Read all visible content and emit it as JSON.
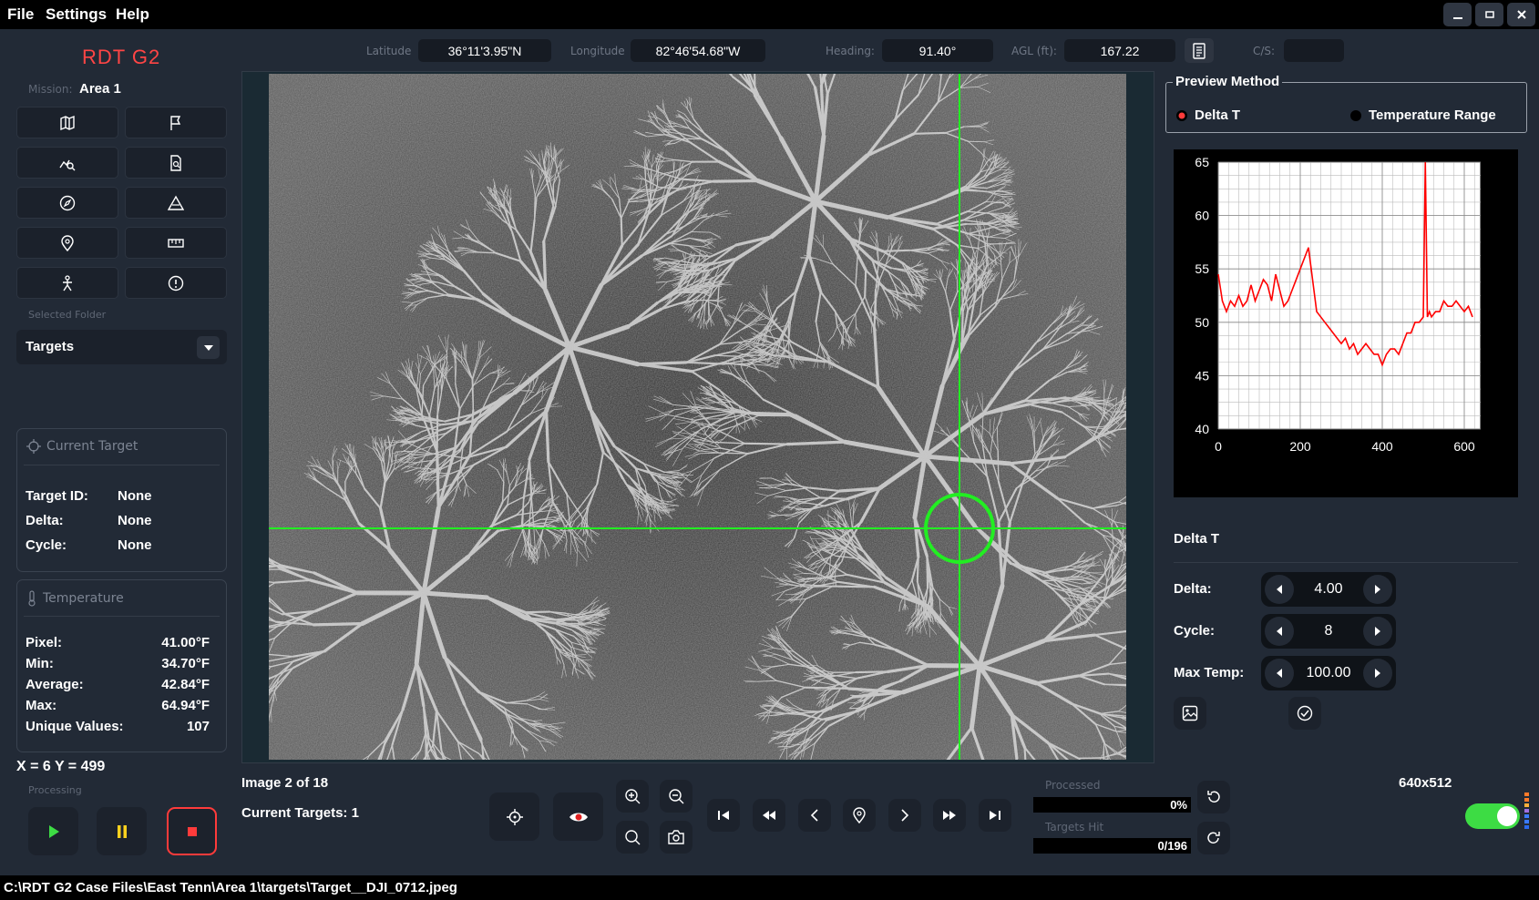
{
  "menu": {
    "file": "File",
    "settings": "Settings",
    "help": "Help"
  },
  "window_buttons": [
    "minimize-icon",
    "maximize-icon",
    "close-icon"
  ],
  "info_bar": {
    "latitude_label": "Latitude",
    "latitude_value": "36°11'3.95\"N",
    "longitude_label": "Longitude",
    "longitude_value": "82°46'54.68\"W",
    "heading_label": "Heading:",
    "heading_value": "91.40°",
    "agl_label": "AGL (ft):",
    "agl_value": "167.22",
    "cs_label": "C/S:",
    "cs_value": ""
  },
  "left": {
    "logo": "RDT G2",
    "mission_label": "Mission:",
    "mission_value": "Area 1",
    "tools": [
      "map-icon",
      "flag-icon",
      "chart-search-icon",
      "document-search-icon",
      "compass-icon",
      "triangle-pattern-icon",
      "pin-icon",
      "measure-icon",
      "person-icon",
      "alert-icon"
    ],
    "selected_folder_label": "Selected Folder",
    "folder_value": "Targets",
    "current_target": {
      "title": "Current Target",
      "target_id_label": "Target ID:",
      "target_id_value": "None",
      "delta_label": "Delta:",
      "delta_value": "None",
      "cycle_label": "Cycle:",
      "cycle_value": "None"
    },
    "temperature": {
      "title": "Temperature",
      "pixel_label": "Pixel:",
      "pixel_value": "41.00°F",
      "min_label": "Min:",
      "min_value": "34.70°F",
      "avg_label": "Average:",
      "avg_value": "42.84°F",
      "max_label": "Max:",
      "max_value": "64.94°F",
      "unique_label": "Unique Values:",
      "unique_value": "107"
    },
    "coords": "X = 6 Y = 499",
    "processing_label": "Processing"
  },
  "bottom": {
    "image_counter": "Image 2 of 18",
    "current_targets": "Current Targets: 1",
    "processed_label": "Processed",
    "processed_value": "0%",
    "processed_fraction": 0,
    "targets_hit_label": "Targets Hit",
    "targets_hit_value": "0/196",
    "targets_hit_fraction": 0,
    "resolution": "640x512",
    "toggle_on": true
  },
  "right": {
    "preview_method_title": "Preview Method",
    "option_delta": "Delta T",
    "option_range": "Temperature Range",
    "selected": "Delta T",
    "delta_t_heading": "Delta T",
    "delta_label": "Delta:",
    "delta_value": "4.00",
    "cycle_label": "Cycle:",
    "cycle_value": "8",
    "max_temp_label": "Max Temp:",
    "max_temp_value": "100.00"
  },
  "colors": {
    "accent_red": "#ff3b3b",
    "crosshair": "#22ee22",
    "toggle_green": "#3ddc44",
    "background": "#222a36"
  },
  "chart_data": {
    "type": "line",
    "xlim": [
      0,
      640
    ],
    "ylim": [
      40,
      65
    ],
    "xticks": [
      0,
      200,
      400,
      600
    ],
    "yticks": [
      40,
      45,
      50,
      55,
      60,
      65
    ],
    "grid": true,
    "series": [
      {
        "color": "#ff0000",
        "x": [
          0,
          10,
          20,
          30,
          40,
          50,
          60,
          70,
          80,
          90,
          100,
          110,
          120,
          130,
          140,
          150,
          160,
          170,
          180,
          190,
          200,
          210,
          220,
          230,
          240,
          250,
          260,
          270,
          280,
          290,
          300,
          310,
          320,
          330,
          340,
          350,
          360,
          370,
          380,
          390,
          400,
          410,
          420,
          430,
          440,
          450,
          460,
          470,
          480,
          490,
          500,
          505,
          510,
          515,
          520,
          530,
          540,
          550,
          560,
          570,
          580,
          590,
          600,
          610,
          620
        ],
        "y": [
          54.5,
          52,
          51,
          52,
          51.5,
          52.5,
          51.5,
          52,
          53.5,
          52,
          53,
          54,
          53.5,
          52,
          54.5,
          53,
          51.5,
          52,
          53,
          54,
          55,
          56,
          57,
          54,
          51,
          50.5,
          50,
          49.5,
          49,
          48.5,
          48,
          48.5,
          47.5,
          48,
          47,
          47.5,
          48,
          47.5,
          47,
          47,
          46,
          47,
          47.5,
          47.5,
          47,
          48,
          49,
          49,
          50,
          50,
          50.5,
          65,
          50.5,
          51,
          50.5,
          51,
          51,
          52,
          51.5,
          51.5,
          52,
          51.5,
          51,
          51.5,
          50.5
        ]
      }
    ]
  }
}
